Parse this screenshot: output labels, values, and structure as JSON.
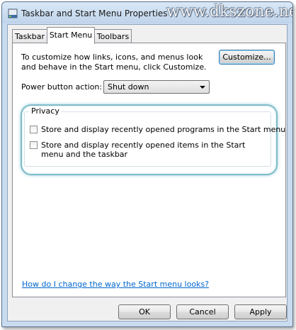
{
  "window": {
    "title": "Taskbar and Start Menu Properties",
    "watermark": "www.dkszone.net"
  },
  "tabs": [
    {
      "label": "Taskbar",
      "active": false
    },
    {
      "label": "Start Menu",
      "active": true
    },
    {
      "label": "Toolbars",
      "active": false
    }
  ],
  "start_menu": {
    "description": "To customize how links, icons, and menus look and behave in the Start menu, click Customize.",
    "customize_button": "Customize...",
    "power_label": "Power button action:",
    "power_value": "Shut down",
    "privacy": {
      "title": "Privacy",
      "options": [
        {
          "label": "Store and display recently opened programs in the Start menu",
          "checked": false
        },
        {
          "label": "Store and display recently opened items in the Start menu and the taskbar",
          "checked": false
        }
      ]
    },
    "help_link": "How do I change the way the Start menu looks?"
  },
  "buttons": {
    "ok": "OK",
    "cancel": "Cancel",
    "apply": "Apply"
  },
  "colors": {
    "highlight_ring": "#7fbcc9",
    "link": "#0066cc",
    "focus_border": "#3c7fb1"
  }
}
